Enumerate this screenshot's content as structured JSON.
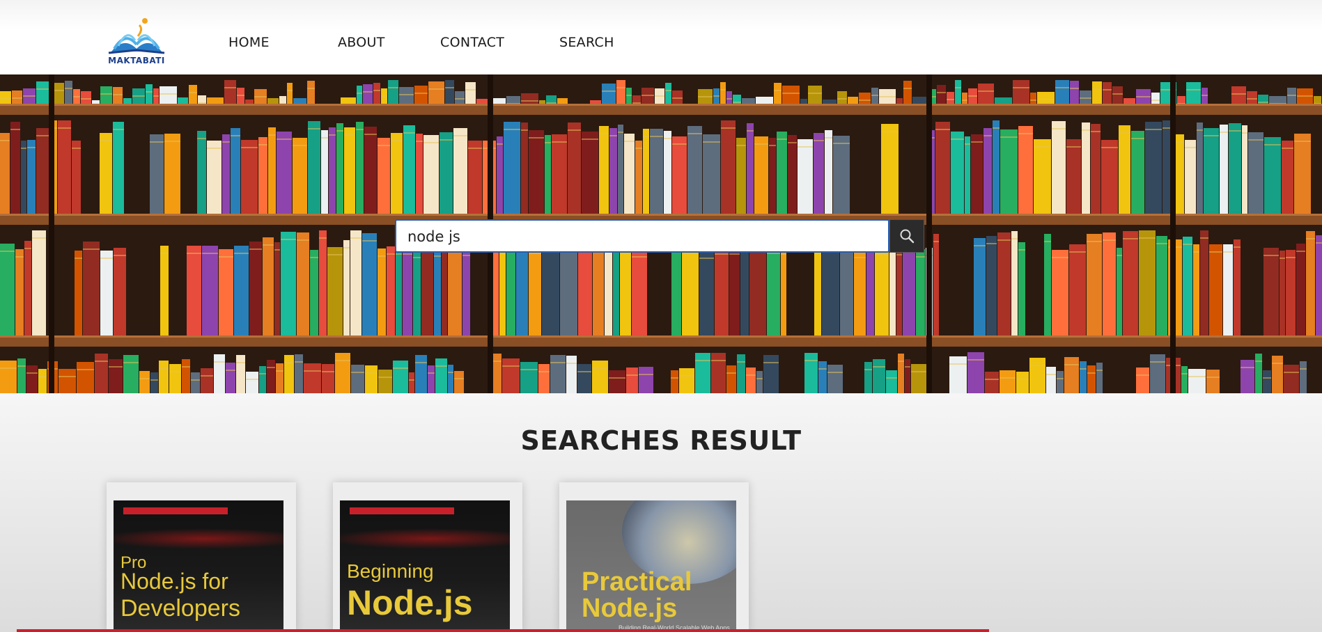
{
  "header": {
    "logo_text": "MAKTABATI",
    "nav": [
      "HOME",
      "ABOUT",
      "CONTACT",
      "SEARCH"
    ]
  },
  "search": {
    "value": "node js"
  },
  "results": {
    "title": "SEARCHES RESULT",
    "books": [
      {
        "line1": "Pro",
        "line2": "Node.js for",
        "line3": "Developers"
      },
      {
        "line1": "Beginning",
        "line2": "Node.js"
      },
      {
        "line1": "Practical",
        "line2": "Node.js",
        "subtitle": "Building Real-World Scalable Web Apps"
      }
    ]
  },
  "colors": {
    "accent_blue": "#2a5db0",
    "nav_text": "#1a1a1a",
    "bottom_bar": "#cc1f2c",
    "cover_title": "#e8c93a"
  }
}
